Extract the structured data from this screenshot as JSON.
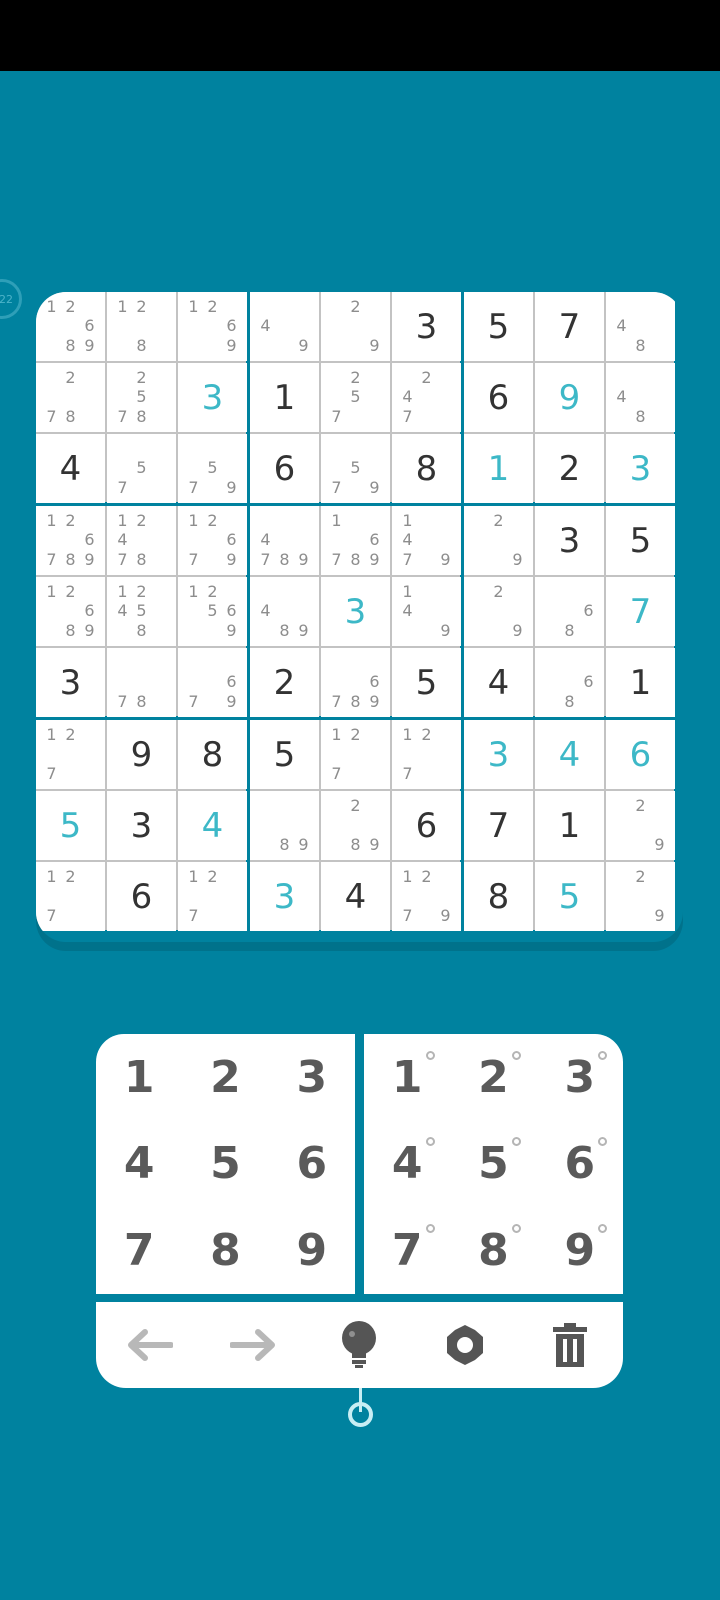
{
  "timer": {
    "label": "22"
  },
  "colors": {
    "background": "#00829f",
    "given": "#333333",
    "user": "#3db8c7",
    "note": "#8d8d8d"
  },
  "board": [
    [
      {
        "n": [
          1,
          2,
          6,
          8,
          9
        ]
      },
      {
        "n": [
          1,
          2,
          8
        ]
      },
      {
        "n": [
          1,
          2,
          6,
          9
        ]
      },
      {
        "n": [
          4,
          9
        ]
      },
      {
        "n": [
          2,
          9
        ]
      },
      {
        "g": 3
      },
      {
        "g": 5
      },
      {
        "g": 7
      },
      {
        "n": [
          4,
          8
        ]
      }
    ],
    [
      {
        "n": [
          2,
          7,
          8
        ]
      },
      {
        "n": [
          2,
          5,
          7,
          8
        ]
      },
      {
        "u": 3
      },
      {
        "g": 1
      },
      {
        "n": [
          2,
          5,
          7
        ]
      },
      {
        "n": [
          2,
          4,
          7
        ]
      },
      {
        "g": 6
      },
      {
        "u": 9
      },
      {
        "n": [
          4,
          8
        ]
      }
    ],
    [
      {
        "g": 4
      },
      {
        "n": [
          5,
          7
        ]
      },
      {
        "n": [
          5,
          7,
          9
        ]
      },
      {
        "g": 6
      },
      {
        "n": [
          5,
          7,
          9
        ]
      },
      {
        "g": 8
      },
      {
        "u": 1
      },
      {
        "g": 2
      },
      {
        "u": 3
      }
    ],
    [
      {
        "n": [
          1,
          2,
          6,
          7,
          8,
          9
        ]
      },
      {
        "n": [
          1,
          2,
          4,
          7,
          8
        ]
      },
      {
        "n": [
          1,
          2,
          6,
          7,
          9
        ]
      },
      {
        "n": [
          4,
          7,
          8,
          9
        ]
      },
      {
        "n": [
          1,
          6,
          7,
          8,
          9
        ]
      },
      {
        "n": [
          1,
          4,
          7,
          9
        ]
      },
      {
        "n": [
          2,
          9
        ]
      },
      {
        "g": 3
      },
      {
        "g": 5
      }
    ],
    [
      {
        "n": [
          1,
          2,
          6,
          8,
          9
        ]
      },
      {
        "n": [
          1,
          2,
          4,
          5,
          8
        ]
      },
      {
        "n": [
          1,
          2,
          5,
          6,
          9
        ]
      },
      {
        "n": [
          4,
          8,
          9
        ]
      },
      {
        "u": 3
      },
      {
        "n": [
          1,
          4,
          9
        ]
      },
      {
        "n": [
          2,
          9
        ]
      },
      {
        "n": [
          6,
          8
        ]
      },
      {
        "u": 7
      }
    ],
    [
      {
        "g": 3
      },
      {
        "n": [
          7,
          8
        ]
      },
      {
        "n": [
          6,
          7,
          9
        ]
      },
      {
        "g": 2
      },
      {
        "n": [
          6,
          7,
          8,
          9
        ]
      },
      {
        "g": 5
      },
      {
        "g": 4
      },
      {
        "n": [
          6,
          8
        ]
      },
      {
        "g": 1
      }
    ],
    [
      {
        "n": [
          1,
          2,
          7
        ]
      },
      {
        "g": 9
      },
      {
        "g": 8
      },
      {
        "g": 5
      },
      {
        "n": [
          1,
          2,
          7
        ]
      },
      {
        "n": [
          1,
          2,
          7
        ]
      },
      {
        "u": 3
      },
      {
        "u": 4
      },
      {
        "u": 6
      }
    ],
    [
      {
        "u": 5
      },
      {
        "g": 3
      },
      {
        "u": 4
      },
      {
        "n": [
          8,
          9
        ]
      },
      {
        "n": [
          2,
          8,
          9
        ]
      },
      {
        "g": 6
      },
      {
        "g": 7
      },
      {
        "g": 1
      },
      {
        "n": [
          2,
          9
        ]
      }
    ],
    [
      {
        "n": [
          1,
          2,
          7
        ]
      },
      {
        "g": 6
      },
      {
        "n": [
          1,
          2,
          7
        ]
      },
      {
        "u": 3
      },
      {
        "g": 4
      },
      {
        "n": [
          1,
          2,
          7,
          9
        ]
      },
      {
        "g": 8
      },
      {
        "u": 5
      },
      {
        "n": [
          2,
          9
        ]
      }
    ]
  ],
  "keypad": {
    "digits": [
      "1",
      "2",
      "3",
      "4",
      "5",
      "6",
      "7",
      "8",
      "9"
    ],
    "note_digits": [
      "1",
      "2",
      "3",
      "4",
      "5",
      "6",
      "7",
      "8",
      "9"
    ]
  },
  "toolbar": {
    "icons": [
      "undo-arrow-icon",
      "redo-arrow-icon",
      "lightbulb-icon",
      "gear-icon",
      "trash-icon"
    ]
  }
}
